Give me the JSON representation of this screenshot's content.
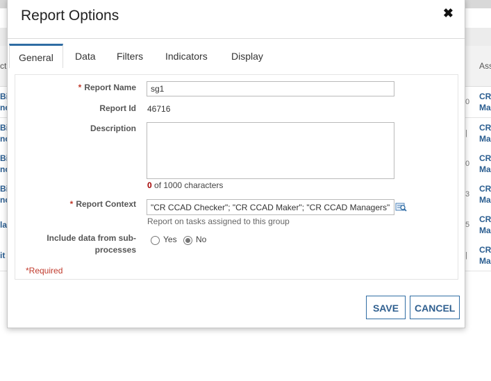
{
  "background": {
    "header_left": "ct",
    "header_right": "Ass",
    "rows": [
      {
        "left": "Bi",
        "left2": "nc",
        "right": "CR",
        "right2": "Ma",
        "mark": "0"
      },
      {
        "left": "Bi",
        "left2": "nc",
        "right": "CR",
        "right2": "Ma",
        "mark": "|"
      },
      {
        "left": "Bi",
        "left2": "nc",
        "right": "CR",
        "right2": "Ma",
        "mark": "0"
      },
      {
        "left": "Bi",
        "left2": "nc",
        "right": "CR",
        "right2": "Ma",
        "mark": "3"
      },
      {
        "left": "la",
        "left2": "",
        "right": "CR",
        "right2": "Ma",
        "mark": "5"
      },
      {
        "left": "it",
        "left2": "",
        "right": "CR",
        "right2": "Ma",
        "mark": "|"
      }
    ]
  },
  "dialog": {
    "title": "Report Options",
    "close_glyph": "✖",
    "tabs": [
      "General",
      "Data",
      "Filters",
      "Indicators",
      "Display"
    ],
    "active_tab": "General",
    "form": {
      "required_star": "*",
      "report_name": {
        "label": "Report Name",
        "value": "sg1"
      },
      "report_id": {
        "label": "Report Id",
        "value": "46716"
      },
      "description": {
        "label": "Description",
        "value": "",
        "count": "0",
        "count_suffix": "of 1000 characters"
      },
      "report_context": {
        "label": "Report Context",
        "value": "\"CR CCAD Checker\"; \"CR CCAD Maker\"; \"CR CCAD Managers\";",
        "hint": "Report on tasks assigned to this group",
        "lookup_icon": "lookup-search-icon"
      },
      "include_data": {
        "label_line1": "Include data from sub-",
        "label_line2": "processes",
        "options": [
          "Yes",
          "No"
        ],
        "selected": "No"
      },
      "required_note": "*Required"
    },
    "buttons": {
      "save": "SAVE",
      "cancel": "CANCEL"
    }
  },
  "colors": {
    "accent": "#2f6ca3",
    "required": "#c0392b",
    "link": "#2a5d90"
  }
}
